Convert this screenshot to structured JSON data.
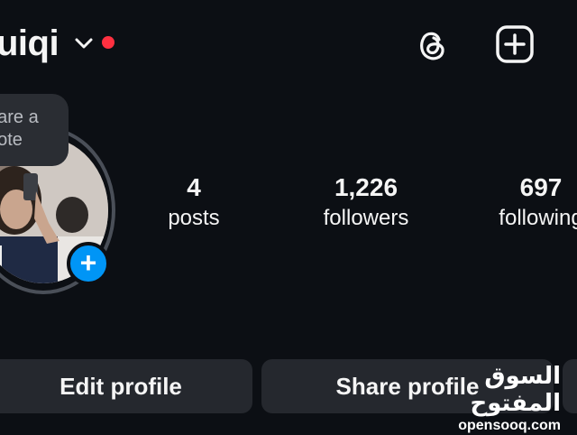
{
  "header": {
    "username": "uiqi"
  },
  "profile": {
    "note_placeholder": "hare a note",
    "add_story_symbol": "+"
  },
  "stats": {
    "posts": {
      "value": "4",
      "label": "posts"
    },
    "followers": {
      "value": "1,226",
      "label": "followers"
    },
    "following": {
      "value": "697",
      "label": "following"
    }
  },
  "actions": {
    "edit_profile": "Edit profile",
    "share_profile": "Share profile"
  },
  "watermark": {
    "arabic": "السوق المفتوح",
    "latin": "opensooq.com"
  },
  "colors": {
    "background": "#0c0f14",
    "button": "#25282e",
    "accent_blue": "#0095f6",
    "notification_red": "#ff3040"
  },
  "icons": [
    "chevron-down-icon",
    "notification-dot",
    "threads-icon",
    "create-icon",
    "plus-icon"
  ]
}
